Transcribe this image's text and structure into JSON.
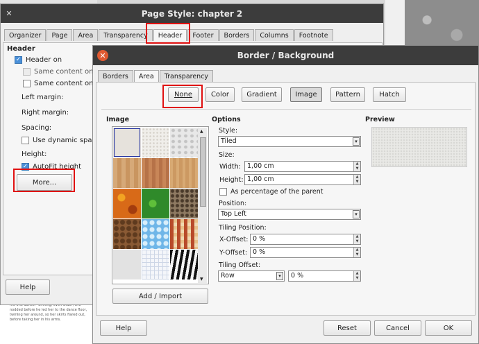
{
  "page_style": {
    "title": "Page Style: chapter 2",
    "tabs": [
      "Organizer",
      "Page",
      "Area",
      "Transparency",
      "Header",
      "Footer",
      "Borders",
      "Columns",
      "Footnote"
    ],
    "active_tab": "Header",
    "section": "Header",
    "header_on": "Header on",
    "same_left": "Same content on left",
    "same_first": "Same content on first",
    "left_margin": "Left margin:",
    "right_margin": "Right margin:",
    "spacing": "Spacing:",
    "dynamic_spacing": "Use dynamic spacing",
    "height": "Height:",
    "autofit": "AutoFit height",
    "more": "More...",
    "help": "Help"
  },
  "border_bg": {
    "title": "Border / Background",
    "tabs": [
      "Borders",
      "Area",
      "Transparency"
    ],
    "active_tab": "Area",
    "fill_buttons": [
      "None",
      "Color",
      "Gradient",
      "Image",
      "Pattern",
      "Hatch"
    ],
    "pressed_button": "Image",
    "image_label": "Image",
    "options_label": "Options",
    "preview_label": "Preview",
    "style_label": "Style:",
    "style_value": "Tiled",
    "size_label": "Size:",
    "width_label": "Width:",
    "width_value": "1,00 cm",
    "height_label": "Height:",
    "height_value": "1,00 cm",
    "percentage_label": "As percentage of the parent",
    "position_label": "Position:",
    "position_value": "Top Left",
    "tiling_position_label": "Tiling Position:",
    "x_offset_label": "X-Offset:",
    "x_offset_value": "0 %",
    "y_offset_label": "Y-Offset:",
    "y_offset_value": "0 %",
    "tiling_offset_label": "Tiling Offset:",
    "tiling_offset_mode": "Row",
    "tiling_offset_value": "0 %",
    "add_import": "Add / Import",
    "help": "Help",
    "reset": "Reset",
    "cancel": "Cancel",
    "ok": "OK"
  },
  "doc_text": "He nodded toward the dance floor. \"You owe me one dance.\" Smiling, even wider, she nodded before he led her to the dance floor, twirling her around, so her skirts flared out, before taking her in his arms.",
  "colors": {
    "titlebar": "#3c3c3c",
    "highlight": "#e01010",
    "close_button": "#e05a32",
    "checkbox": "#4a90d9"
  }
}
